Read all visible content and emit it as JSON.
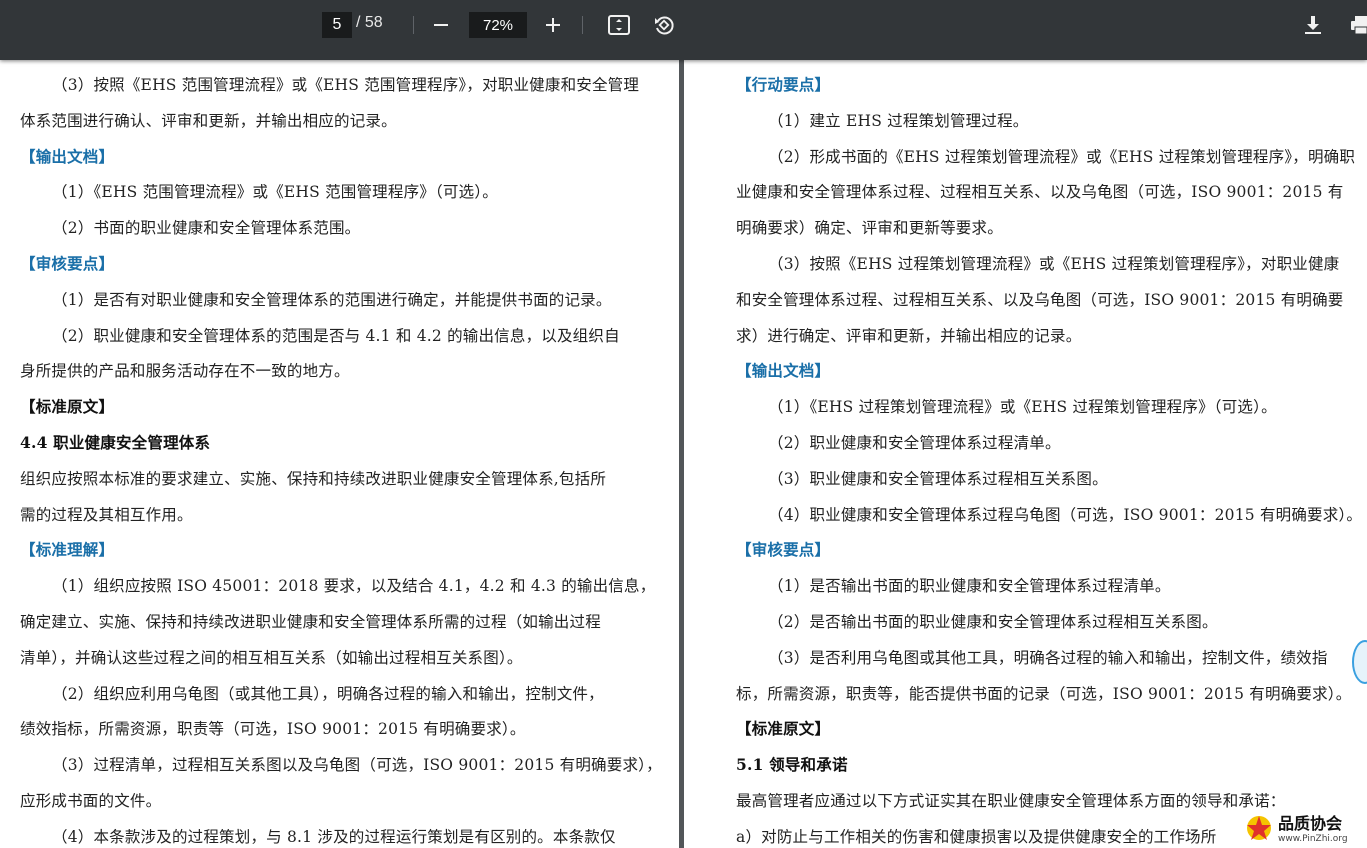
{
  "toolbar": {
    "current_page": "5",
    "total_pages": "/ 58",
    "zoom": "72%"
  },
  "left_page": {
    "lines": [
      {
        "text": "（3）按照《EHS 范围管理流程》或《EHS 范围管理程序》，对职业健康和安全管理",
        "style": "normal",
        "indent": true
      },
      {
        "text": "体系范围进行确认、评审和更新，并输出相应的记录。",
        "style": "normal",
        "indent": false
      },
      {
        "text": "【输出文档】",
        "style": "heading",
        "indent": false
      },
      {
        "text": "（1）《EHS 范围管理流程》或《EHS 范围管理程序》（可选）。",
        "style": "normal",
        "indent": true
      },
      {
        "text": "（2）书面的职业健康和安全管理体系范围。",
        "style": "normal",
        "indent": true
      },
      {
        "text": "【审核要点】",
        "style": "heading",
        "indent": false
      },
      {
        "text": "（1）是否有对职业健康和安全管理体系的范围进行确定，并能提供书面的记录。",
        "style": "normal",
        "indent": true
      },
      {
        "text": "（2）职业健康和安全管理体系的范围是否与 4.1 和 4.2 的输出信息，以及组织自",
        "style": "normal",
        "indent": true
      },
      {
        "text": "身所提供的产品和服务活动存在不一致的地方。",
        "style": "normal",
        "indent": false
      },
      {
        "text": "【标准原文】",
        "style": "bold",
        "indent": false
      },
      {
        "text": "4.4 职业健康安全管理体系",
        "style": "bold",
        "indent": false
      },
      {
        "text": "组织应按照本标准的要求建立、实施、保持和持续改进职业健康安全管理体系,包括所",
        "style": "normal",
        "indent": false
      },
      {
        "text": "需的过程及其相互作用。",
        "style": "normal",
        "indent": false
      },
      {
        "text": "【标准理解】",
        "style": "heading",
        "indent": false
      },
      {
        "text": "（1）组织应按照 ISO 45001：2018 要求，以及结合 4.1，4.2 和 4.3 的输出信息，",
        "style": "normal",
        "indent": true
      },
      {
        "text": "确定建立、实施、保持和持续改进职业健康和安全管理体系所需的过程（如输出过程",
        "style": "normal",
        "indent": false
      },
      {
        "text": "清单），并确认这些过程之间的相互相互关系（如输出过程相互关系图）。",
        "style": "normal",
        "indent": false
      },
      {
        "text": "（2）组织应利用乌龟图（或其他工具），明确各过程的输入和输出，控制文件，",
        "style": "normal",
        "indent": true
      },
      {
        "text": "绩效指标，所需资源，职责等（可选，ISO 9001：2015 有明确要求）。",
        "style": "normal",
        "indent": false
      },
      {
        "text": "（3）过程清单，过程相互关系图以及乌龟图（可选，ISO 9001：2015 有明确要求），",
        "style": "normal",
        "indent": true
      },
      {
        "text": "应形成书面的文件。",
        "style": "normal",
        "indent": false
      },
      {
        "text": "（4）本条款涉及的过程策划，与 8.1 涉及的过程运行策划是有区别的。本条款仅",
        "style": "normal",
        "indent": true
      }
    ]
  },
  "right_page": {
    "lines": [
      {
        "text": "【行动要点】",
        "style": "heading",
        "indent": false
      },
      {
        "text": "（1）建立 EHS 过程策划管理过程。",
        "style": "normal",
        "indent": true
      },
      {
        "text": "（2）形成书面的《EHS 过程策划管理流程》或《EHS 过程策划管理程序》，明确职",
        "style": "normal",
        "indent": true
      },
      {
        "text": "业健康和安全管理体系过程、过程相互关系、以及乌龟图（可选，ISO 9001：2015 有",
        "style": "normal",
        "indent": false
      },
      {
        "text": "明确要求）确定、评审和更新等要求。",
        "style": "normal",
        "indent": false
      },
      {
        "text": "（3）按照《EHS 过程策划管理流程》或《EHS 过程策划管理程序》，对职业健康",
        "style": "normal",
        "indent": true
      },
      {
        "text": "和安全管理体系过程、过程相互关系、以及乌龟图（可选，ISO 9001：2015 有明确要",
        "style": "normal",
        "indent": false
      },
      {
        "text": "求）进行确定、评审和更新，并输出相应的记录。",
        "style": "normal",
        "indent": false
      },
      {
        "text": "【输出文档】",
        "style": "heading",
        "indent": false
      },
      {
        "text": "（1）《EHS 过程策划管理流程》或《EHS 过程策划管理程序》（可选）。",
        "style": "normal",
        "indent": true
      },
      {
        "text": "（2）职业健康和安全管理体系过程清单。",
        "style": "normal",
        "indent": true
      },
      {
        "text": "（3）职业健康和安全管理体系过程相互关系图。",
        "style": "normal",
        "indent": true
      },
      {
        "text": "（4）职业健康和安全管理体系过程乌龟图（可选，ISO 9001：2015 有明确要求）。",
        "style": "normal",
        "indent": true
      },
      {
        "text": "【审核要点】",
        "style": "heading",
        "indent": false
      },
      {
        "text": "（1）是否输出书面的职业健康和安全管理体系过程清单。",
        "style": "normal",
        "indent": true
      },
      {
        "text": "（2）是否输出书面的职业健康和安全管理体系过程相互关系图。",
        "style": "normal",
        "indent": true
      },
      {
        "text": "（3）是否利用乌龟图或其他工具，明确各过程的输入和输出，控制文件，绩效指",
        "style": "normal",
        "indent": true
      },
      {
        "text": "标，所需资源，职责等，能否提供书面的记录（可选，ISO 9001：2015 有明确要求）。",
        "style": "normal",
        "indent": false
      },
      {
        "text": "【标准原文】",
        "style": "bold",
        "indent": false
      },
      {
        "text": "5.1 领导和承诺",
        "style": "bold",
        "indent": false
      },
      {
        "text": "最高管理者应通过以下方式证实其在职业健康安全管理体系方面的领导和承诺：",
        "style": "normal",
        "indent": false
      },
      {
        "text": "a）对防止与工作相关的伤害和健康损害以及提供健康安全的工作场所",
        "style": "normal",
        "indent": false
      }
    ]
  },
  "watermark": {
    "title": "品质协会",
    "url": "www.PinZhi.org"
  }
}
